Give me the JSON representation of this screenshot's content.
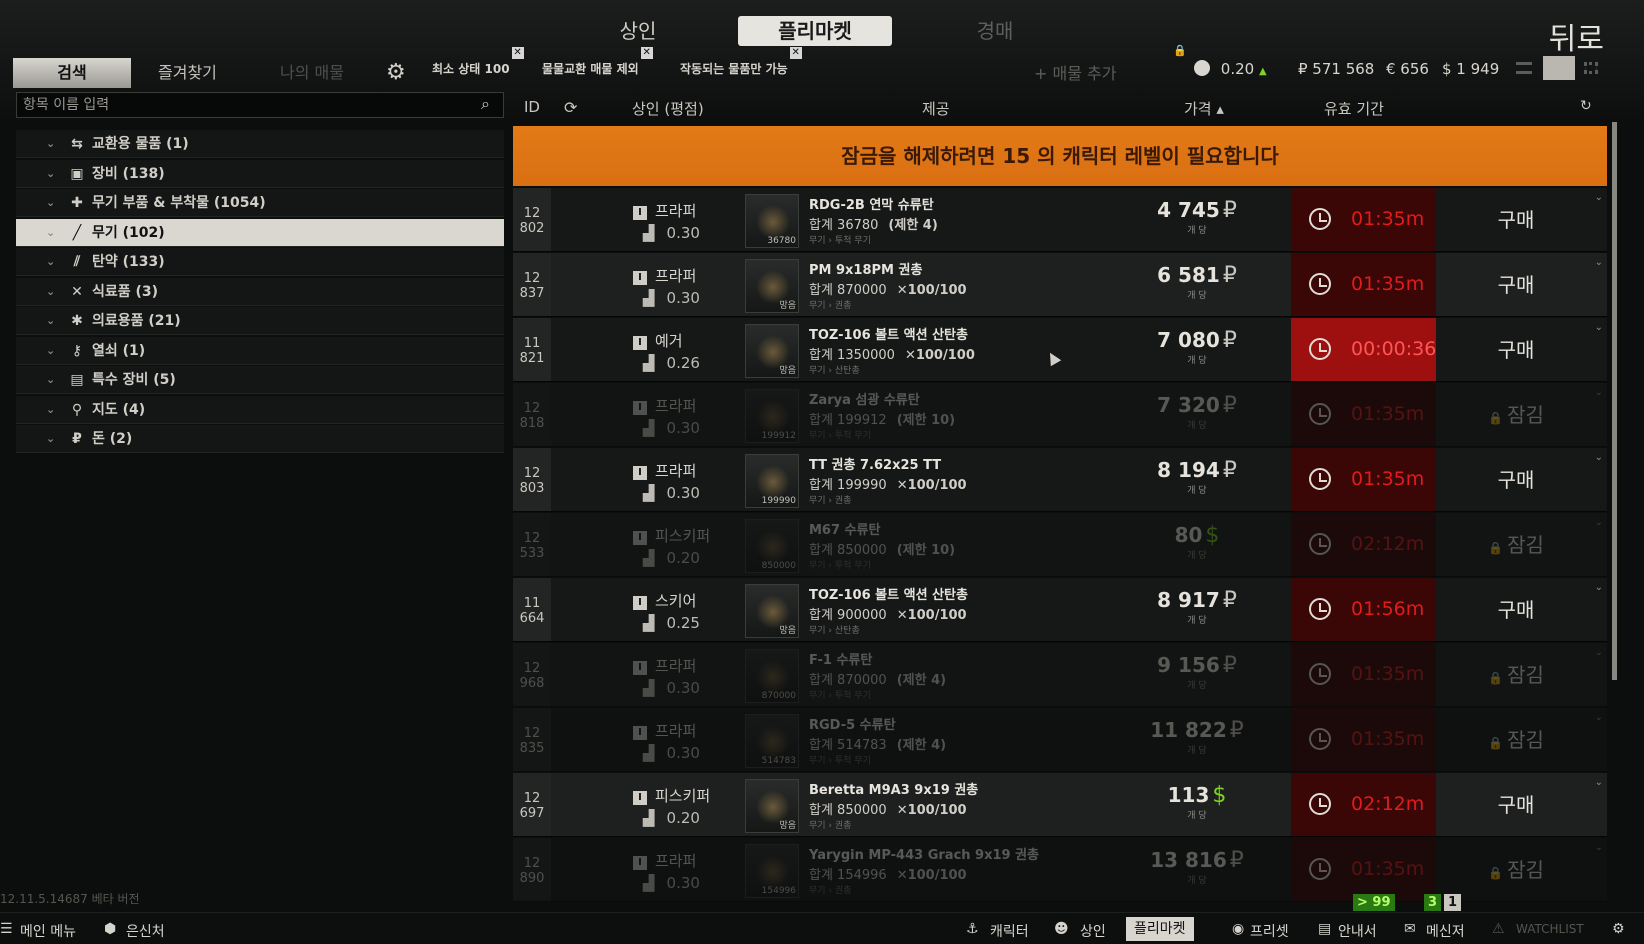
{
  "main_tabs": {
    "trader": "상인",
    "flea": "플리마켓",
    "auction": "경매",
    "back": "뒤로"
  },
  "sub_tabs": {
    "search": "검색",
    "favorites": "즐겨찾기",
    "my_offers": "나의 매물"
  },
  "filters": [
    "최소 상태 100",
    "물물교환 매물 제외",
    "작동되는 물품만 가능"
  ],
  "add_offer": "+ 매물 추가",
  "balance": {
    "rating": "0.20",
    "rub": "₽ 571 568",
    "eur": "€ 656",
    "usd": "$ 1 949"
  },
  "search": {
    "placeholder": "항목 이름 입력"
  },
  "categories": [
    {
      "label": "교환용 물품 (1)",
      "icon": "barter-icon"
    },
    {
      "label": "장비 (138)",
      "icon": "gear-vest-icon"
    },
    {
      "label": "무기 부품 & 부착물 (1054)",
      "icon": "weapon-parts-icon"
    },
    {
      "label": "무기 (102)",
      "icon": "rifle-icon",
      "selected": true
    },
    {
      "label": "탄약 (133)",
      "icon": "ammo-icon"
    },
    {
      "label": "식료품 (3)",
      "icon": "food-icon"
    },
    {
      "label": "의료용품 (21)",
      "icon": "medical-icon"
    },
    {
      "label": "열쇠 (1)",
      "icon": "key-icon"
    },
    {
      "label": "특수 장비 (5)",
      "icon": "special-equipment-icon"
    },
    {
      "label": "지도 (4)",
      "icon": "map-icon"
    },
    {
      "label": "돈 (2)",
      "icon": "money-icon"
    }
  ],
  "table_header": {
    "id": "ID",
    "trader": "상인 (평점)",
    "offer": "제공",
    "price": "가격 ▴",
    "expiry": "유효 기간"
  },
  "banner": "잠금을 해제하려면 15 의 캐릭터 레벨이 필요합니다",
  "rows": [
    {
      "id1": "12",
      "id2": "802",
      "trader": "프라퍼",
      "rating": "0.30",
      "name": "RDG-2B 연막 슈류탄",
      "total": "합계 36780",
      "cond": "(제한 4)",
      "cat": "무기 › 투척 무기",
      "thumb": "36780",
      "price": "4 745",
      "cur": "₽",
      "unit": "개 당",
      "timer": "01:35m",
      "action": "구매",
      "locked": false,
      "urgent": false
    },
    {
      "id1": "12",
      "id2": "837",
      "trader": "프라퍼",
      "rating": "0.30",
      "name": "PM 9x18PM 권총",
      "total": "합계 870000",
      "cond": "✕100/100",
      "cat": "무기 › 권총",
      "thumb": "망음",
      "price": "6 581",
      "cur": "₽",
      "unit": "개 당",
      "timer": "01:35m",
      "action": "구매",
      "locked": false,
      "urgent": false
    },
    {
      "id1": "11",
      "id2": "821",
      "trader": "예거",
      "rating": "0.26",
      "name": "TOZ-106 볼트 액션 산탄총",
      "total": "합계 1350000",
      "cond": "✕100/100",
      "cat": "무기 › 산탄총",
      "thumb": "망음",
      "price": "7 080",
      "cur": "₽",
      "unit": "개 당",
      "timer": "00:00:36",
      "action": "구매",
      "locked": false,
      "urgent": true
    },
    {
      "id1": "12",
      "id2": "818",
      "trader": "프라퍼",
      "rating": "0.30",
      "name": "Zarya 섬광 수류탄",
      "total": "합계 199912",
      "cond": "(제한 10)",
      "cat": "무기 › 투척 무기",
      "thumb": "199912",
      "price": "7 320",
      "cur": "₽",
      "unit": "개 당",
      "timer": "01:35m",
      "action": "잠김",
      "locked": true,
      "urgent": false
    },
    {
      "id1": "12",
      "id2": "803",
      "trader": "프라퍼",
      "rating": "0.30",
      "name": "TT 권총 7.62x25 TT",
      "total": "합계 199990",
      "cond": "✕100/100",
      "cat": "무기 › 권총",
      "thumb": "199990",
      "price": "8 194",
      "cur": "₽",
      "unit": "개 당",
      "timer": "01:35m",
      "action": "구매",
      "locked": false,
      "urgent": false
    },
    {
      "id1": "12",
      "id2": "533",
      "trader": "피스키퍼",
      "rating": "0.20",
      "name": "M67 수류탄",
      "total": "합계 850000",
      "cond": "(제한 10)",
      "cat": "무기 › 투척 무기",
      "thumb": "850000",
      "price": "80",
      "cur": "$",
      "unit": "개 당",
      "timer": "02:12m",
      "action": "잠김",
      "locked": true,
      "urgent": false
    },
    {
      "id1": "11",
      "id2": "664",
      "trader": "스키어",
      "rating": "0.25",
      "name": "TOZ-106 볼트 액션 산탄총",
      "total": "합계 900000",
      "cond": "✕100/100",
      "cat": "무기 › 산탄총",
      "thumb": "망음",
      "price": "8 917",
      "cur": "₽",
      "unit": "개 당",
      "timer": "01:56m",
      "action": "구매",
      "locked": false,
      "urgent": false
    },
    {
      "id1": "12",
      "id2": "968",
      "trader": "프라퍼",
      "rating": "0.30",
      "name": "F-1 수류탄",
      "total": "합계 870000",
      "cond": "(제한 4)",
      "cat": "무기 › 투척 무기",
      "thumb": "870000",
      "price": "9 156",
      "cur": "₽",
      "unit": "개 당",
      "timer": "01:35m",
      "action": "잠김",
      "locked": true,
      "urgent": false
    },
    {
      "id1": "12",
      "id2": "835",
      "trader": "프라퍼",
      "rating": "0.30",
      "name": "RGD-5 수류탄",
      "total": "합계 514783",
      "cond": "(제한 4)",
      "cat": "무기 › 투척 무기",
      "thumb": "514783",
      "price": "11 822",
      "cur": "₽",
      "unit": "개 당",
      "timer": "01:35m",
      "action": "잠김",
      "locked": true,
      "urgent": false
    },
    {
      "id1": "12",
      "id2": "697",
      "trader": "피스키퍼",
      "rating": "0.20",
      "name": "Beretta M9A3 9x19 권총",
      "total": "합계 850000",
      "cond": "✕100/100",
      "cat": "무기 › 권총",
      "thumb": "망음",
      "price": "113",
      "cur": "$",
      "unit": "개 당",
      "timer": "02:12m",
      "action": "구매",
      "locked": false,
      "urgent": false
    },
    {
      "id1": "12",
      "id2": "890",
      "trader": "프라퍼",
      "rating": "0.30",
      "name": "Yarygin MP-443 Grach 9x19 권총",
      "total": "합계 154996",
      "cond": "✕100/100",
      "cat": "무기 › 권총",
      "thumb": "154996",
      "price": "13 816",
      "cur": "₽",
      "unit": "개 당",
      "timer": "01:35m",
      "action": "잠김",
      "locked": true,
      "urgent": false
    }
  ],
  "version": "12.11.5.14687 베타 버전",
  "badges": {
    "b1": "> 99",
    "b2": "3",
    "b3": "1"
  },
  "bottom_bar": {
    "main_menu": "메인 메뉴",
    "hideout": "은신처",
    "character": "캐릭터",
    "traders": "상인",
    "flea": "플리마켓",
    "builds": "프리셋",
    "handbook": "안내서",
    "messenger": "메신저",
    "watchlist": "WATCHLIST"
  },
  "colors": {
    "banner": "#e37a16",
    "timer_urgent": "#9e1010",
    "timer": "#3a0606",
    "usd": "#7ed321"
  }
}
